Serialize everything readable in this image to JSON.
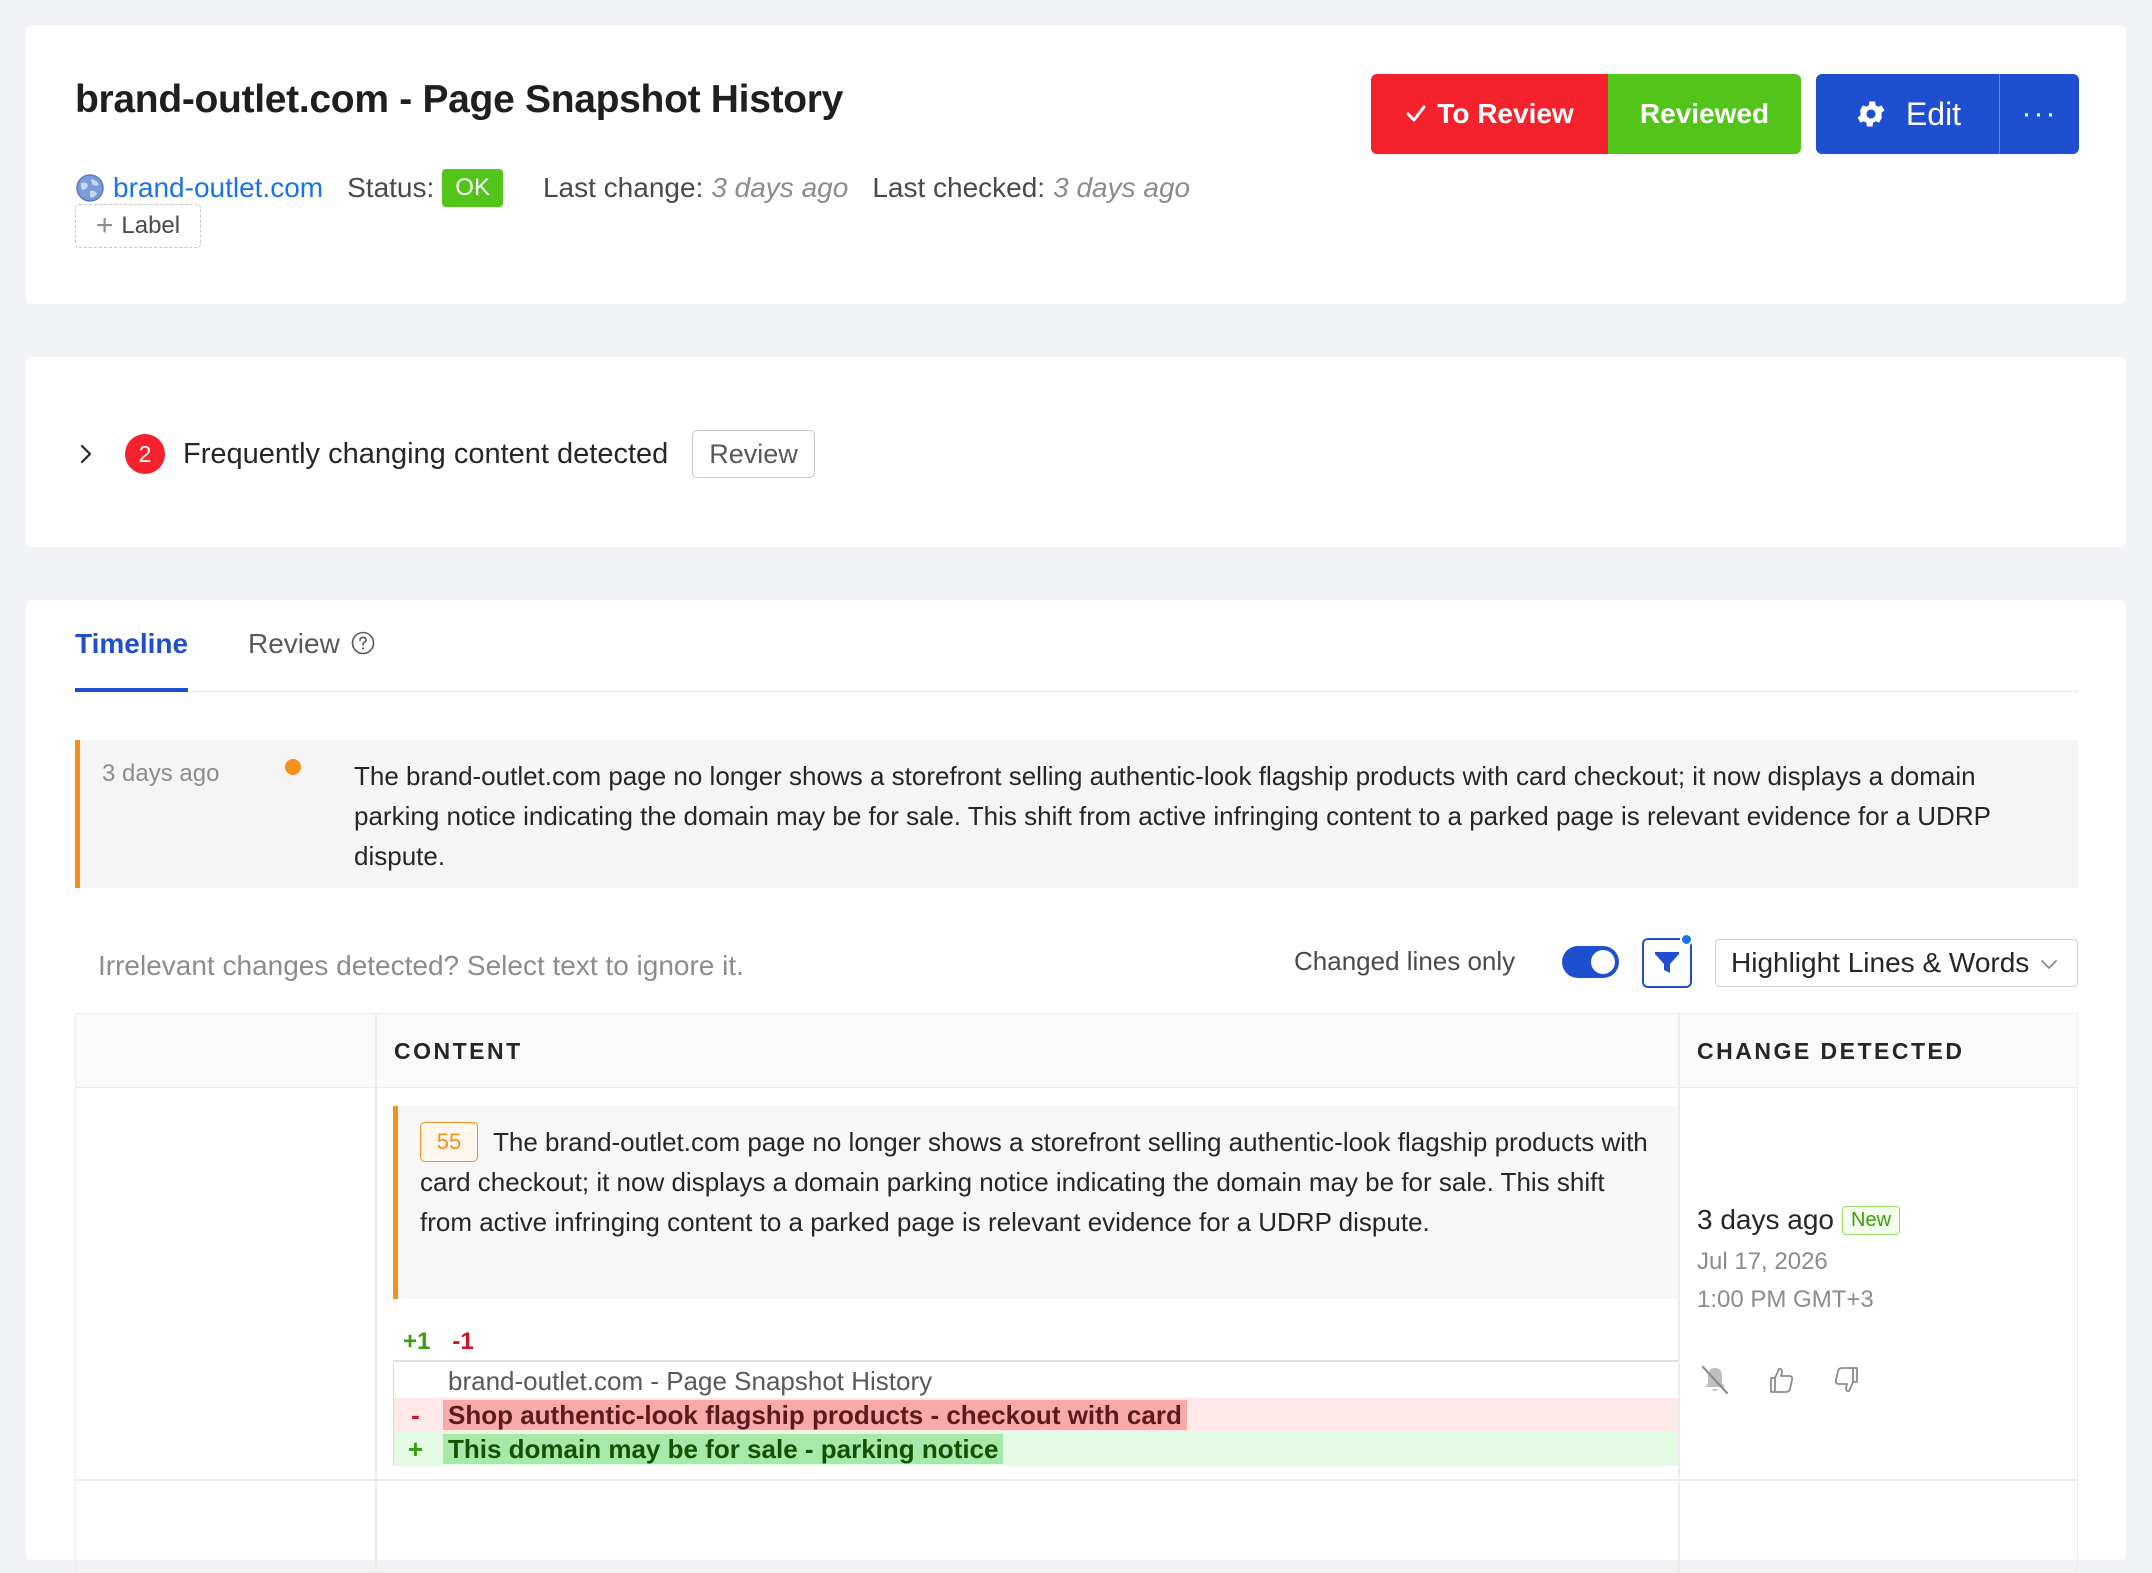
{
  "header": {
    "title": "brand-outlet.com - Page Snapshot History",
    "site_link": "brand-outlet.com",
    "status_label": "Status:",
    "status_value": "OK",
    "last_change_label": "Last change:",
    "last_change_value": "3 days ago",
    "last_checked_label": "Last checked:",
    "last_checked_value": "3 days ago",
    "label_button": "Label",
    "to_review_button": "To Review",
    "reviewed_button": "Reviewed",
    "edit_button": "Edit",
    "more_button": "···",
    "colors": {
      "to_review": "#f5222d",
      "reviewed": "#52c41a",
      "edit": "#1f4fd1"
    }
  },
  "frequent": {
    "count": "2",
    "text": "Frequently changing content detected",
    "review_button": "Review"
  },
  "tabs": [
    {
      "label": "Timeline",
      "active": true
    },
    {
      "label": "Review",
      "active": false,
      "icon": "help-icon"
    }
  ],
  "summary": {
    "time": "3 days ago",
    "text": "The brand-outlet.com page no longer shows a storefront selling authentic-look flagship products with card checkout; it now displays a domain parking notice indicating the domain may be for sale. This shift from active infringing content to a parked page is relevant evidence for a UDRP dispute."
  },
  "toolbar": {
    "hint": "Irrelevant changes detected? Select text to ignore it.",
    "changed_lines_label": "Changed lines only",
    "changed_lines_on": true,
    "highlight_mode": "Highlight Lines & Words"
  },
  "table": {
    "headers": {
      "content": "CONTENT",
      "change_detected": "CHANGE DETECTED"
    },
    "row": {
      "score": "55",
      "note": "The brand-outlet.com page no longer shows a storefront selling authentic-look flagship products with card checkout; it now displays a domain parking notice indicating the domain may be for sale. This shift from active infringing content to a parked page is relevant evidence for a UDRP dispute.",
      "added_count": "+1",
      "removed_count": "-1",
      "diff": {
        "context": "brand-outlet.com - Page Snapshot History",
        "removed_marker": "-",
        "removed": "Shop authentic-look flagship products - checkout with card",
        "added_marker": "+",
        "added": "This domain may be for sale - parking notice"
      },
      "change_relative": "3 days ago",
      "new_badge": "New",
      "change_date": "Jul 17, 2026",
      "change_time": "1:00 PM GMT+3"
    }
  }
}
